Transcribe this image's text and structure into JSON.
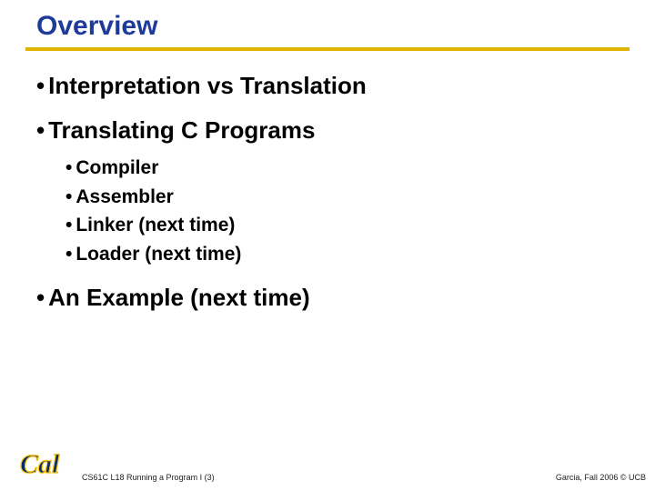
{
  "title": "Overview",
  "bullets": {
    "b1": "Interpretation vs Translation",
    "b2": "Translating C Programs",
    "sub": {
      "s1": "Compiler",
      "s2": "Assembler",
      "s3": "Linker (next time)",
      "s4": "Loader (next time)"
    },
    "b3": "An Example (next time)"
  },
  "footer": {
    "left": "CS61C L18 Running a Program I (3)",
    "right": "Garcia, Fall 2006 © UCB"
  },
  "logo_text": "Cal",
  "colors": {
    "title": "#1f3b99",
    "rule": "#e0b400",
    "cal_blue": "#0a2a66",
    "cal_gold": "#f5c518"
  }
}
